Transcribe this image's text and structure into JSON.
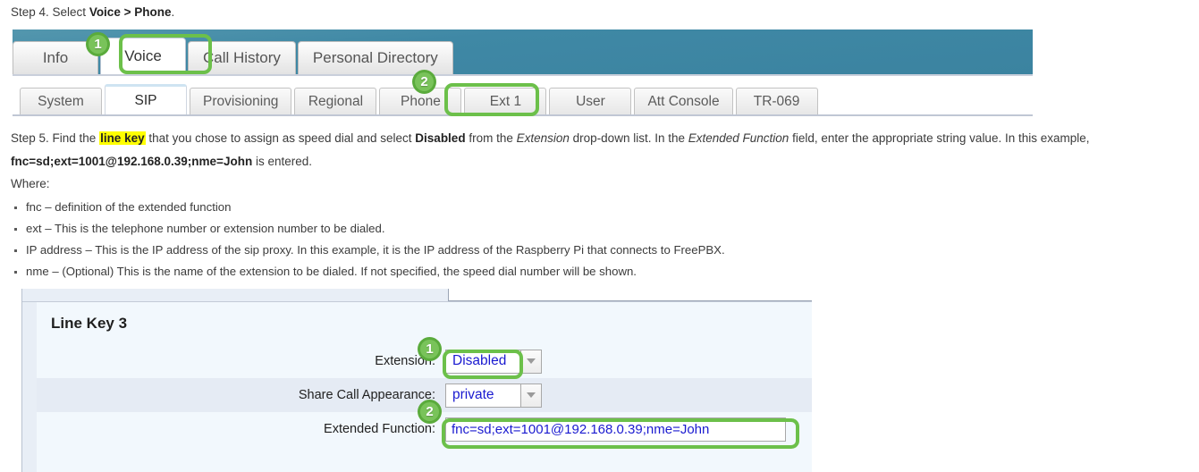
{
  "step4": {
    "prefix": "Step 4. Select ",
    "bold": "Voice > Phone",
    "suffix": "."
  },
  "primary_tabs": [
    {
      "label": "Info",
      "active": false
    },
    {
      "label": "Voice",
      "active": true
    },
    {
      "label": "Call History",
      "active": false
    },
    {
      "label": "Personal Directory",
      "active": false
    }
  ],
  "secondary_tabs": [
    {
      "label": "System",
      "active": false
    },
    {
      "label": "SIP",
      "active": true
    },
    {
      "label": "Provisioning",
      "active": false
    },
    {
      "label": "Regional",
      "active": false
    },
    {
      "label": "Phone",
      "active": false
    },
    {
      "label": "Ext 1",
      "active": false
    },
    {
      "label": "User",
      "active": false
    },
    {
      "label": "Att Console",
      "active": false
    },
    {
      "label": "TR-069",
      "active": false
    }
  ],
  "callouts": {
    "badge1_tabs": "1",
    "badge2_tabs": "2",
    "badge1_form": "1",
    "badge2_form": "2"
  },
  "step5": {
    "p1_a": "Step 5. Find the ",
    "p1_hl": "line key",
    "p1_b": " that you chose to assign as speed dial and select ",
    "p1_bold1": "Disabled",
    "p1_c": " from the ",
    "p1_ital1": "Extension",
    "p1_d": " drop-down list. In the ",
    "p1_ital2": "Extended Function",
    "p1_e": " field, enter the appropriate string value. In this example,",
    "p2_bold": "fnc=sd;ext=1001@192.168.0.39;nme=John",
    "p2_tail": " is entered.",
    "where": "Where:"
  },
  "bullets": [
    "fnc – definition of the extended function",
    "ext – This is the telephone number or extension number to be dialed.",
    "IP address – This is the IP address of the sip proxy. In this example, it is the IP address of the Raspberry Pi that connects to FreePBX.",
    "nme – (Optional) This is the name of the extension to be dialed. If not specified, the speed dial number will be shown."
  ],
  "form": {
    "section_title": "Line Key 3",
    "rows": [
      {
        "label": "Extension:",
        "value": "Disabled",
        "type": "select"
      },
      {
        "label": "Share Call Appearance:",
        "value": "private",
        "type": "select"
      },
      {
        "label": "Extended Function:",
        "value": "fnc=sd;ext=1001@192.168.0.39;nme=John",
        "type": "text"
      }
    ]
  },
  "colors": {
    "accent_green": "#6cc04a",
    "badge_green": "#5aab3c",
    "header_teal": "#3f88a5",
    "field_blue": "#1a1ad0",
    "highlight_yellow": "#ffff00"
  }
}
